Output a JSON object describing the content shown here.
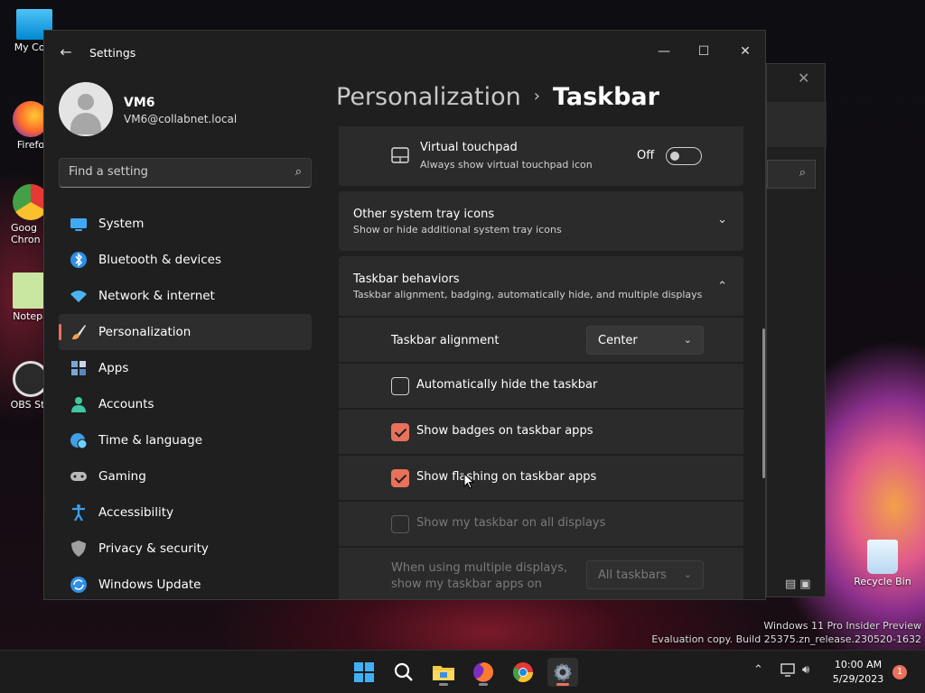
{
  "desktop": {
    "icons": [
      {
        "label": "My Com"
      },
      {
        "label": "Firefo"
      },
      {
        "label": "Goog Chron"
      },
      {
        "label": "Notepa"
      },
      {
        "label": "OBS Stu"
      },
      {
        "label": "Recycle Bin"
      }
    ]
  },
  "window": {
    "title": "Settings",
    "back_glyph": "←",
    "minimize_glyph": "—",
    "maximize_glyph": "☐",
    "close_glyph": "✕"
  },
  "user": {
    "name": "VM6",
    "email": "VM6@collabnet.local"
  },
  "search": {
    "placeholder": "Find a setting"
  },
  "nav": [
    {
      "label": "System",
      "icon": "monitor-icon",
      "color": "#3fa9f5"
    },
    {
      "label": "Bluetooth & devices",
      "icon": "bluetooth-icon",
      "color": "#2e8fe6"
    },
    {
      "label": "Network & internet",
      "icon": "wifi-icon",
      "color": "#4db3f0"
    },
    {
      "label": "Personalization",
      "icon": "paintbrush-icon",
      "color": "#f0a050",
      "active": true
    },
    {
      "label": "Apps",
      "icon": "apps-icon",
      "color": "#7aa6d8"
    },
    {
      "label": "Accounts",
      "icon": "person-icon",
      "color": "#3ec7a0"
    },
    {
      "label": "Time & language",
      "icon": "globe-clock-icon",
      "color": "#3fa0e6"
    },
    {
      "label": "Gaming",
      "icon": "gamepad-icon",
      "color": "#b9b9b9"
    },
    {
      "label": "Accessibility",
      "icon": "accessibility-icon",
      "color": "#3aa0f0"
    },
    {
      "label": "Privacy & security",
      "icon": "shield-icon",
      "color": "#a0a0a0"
    },
    {
      "label": "Windows Update",
      "icon": "update-icon",
      "color": "#2e8fe6"
    }
  ],
  "breadcrumb": {
    "parent": "Personalization",
    "separator": "›",
    "current": "Taskbar"
  },
  "content": {
    "virtual_touchpad": {
      "title": "Virtual touchpad",
      "desc": "Always show virtual touchpad icon",
      "state_label": "Off"
    },
    "tray_icons": {
      "title": "Other system tray icons",
      "desc": "Show or hide additional system tray icons"
    },
    "behaviors": {
      "title": "Taskbar behaviors",
      "desc": "Taskbar alignment, badging, automatically hide, and multiple displays",
      "alignment_label": "Taskbar alignment",
      "alignment_value": "Center",
      "options": [
        {
          "label": "Automatically hide the taskbar",
          "checked": false,
          "disabled": false
        },
        {
          "label": "Show badges on taskbar apps",
          "checked": true,
          "disabled": false
        },
        {
          "label": "Show flashing on taskbar apps",
          "checked": true,
          "disabled": false
        },
        {
          "label": "Show my taskbar on all displays",
          "checked": false,
          "disabled": true
        }
      ],
      "multi_display_label_1": "When using multiple displays,",
      "multi_display_label_2": "show my taskbar apps on",
      "multi_display_value": "All taskbars"
    }
  },
  "watermark": {
    "line1": "Windows 11 Pro Insider Preview",
    "line2": "Evaluation copy. Build 25375.zn_release.230520-1632"
  },
  "taskbar": {
    "time": "10:00 AM",
    "date": "5/29/2023",
    "notification_count": "1",
    "accent": "#e8715b"
  }
}
